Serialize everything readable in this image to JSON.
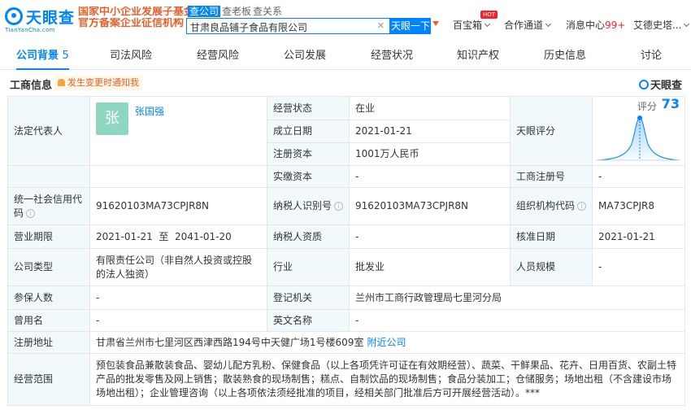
{
  "header": {
    "logo_text": "天眼查",
    "logo_domain": "TianYanCha.com",
    "banner_line1": "国家中小企业发展子基金",
    "banner_line2": "官方备案企业征信机构",
    "query_tabs": [
      "查公司",
      "查老板",
      "查关系"
    ],
    "search_value": "甘肃良品铺子食品有限公司",
    "search_button": "天眼一下",
    "nav": {
      "baibaoxiang": "百宝箱",
      "hot": "HOT",
      "channel": "合作通道",
      "messages": "消息中心",
      "messages_count": "99+",
      "user": "艾德史塔..."
    }
  },
  "tabs": [
    {
      "label": "公司背景",
      "count": "5"
    },
    {
      "label": "司法风险"
    },
    {
      "label": "经营风险"
    },
    {
      "label": "公司发展"
    },
    {
      "label": "经营状况"
    },
    {
      "label": "知识产权"
    },
    {
      "label": "历史信息"
    },
    {
      "label": "讨论"
    }
  ],
  "section": {
    "title": "工商信息",
    "alert": "发生变更时通知我",
    "brand": "天眼查"
  },
  "colors": {
    "accent": "#0084ff",
    "label_bg": "#f2f9fc",
    "alert": "#e8612c"
  },
  "biz": {
    "legal_rep_label": "法定代表人",
    "legal_rep_avatar": "张",
    "legal_rep_name": "张国强",
    "status_label": "经营状态",
    "status_value": "在业",
    "founded_label": "成立日期",
    "founded_value": "2021-01-21",
    "reg_capital_label": "注册资本",
    "reg_capital_value": "1001万人民币",
    "paid_capital_label": "实缴资本",
    "paid_capital_value": "-",
    "score_label": "天眼评分",
    "score_title": "评分",
    "score_value": "73",
    "reg_no_label": "工商注册号",
    "reg_no_value": "-",
    "credit_code_label": "统一社会信用代码",
    "credit_code_value": "91620103MA73CPJR8N",
    "taxpayer_id_label": "纳税人识别号",
    "taxpayer_id_value": "91620103MA73CPJR8N",
    "org_code_label": "组织机构代码",
    "org_code_value": "MA73CPJR8",
    "term_label": "营业期限",
    "term_value": "2021-01-21  至  2041-01-20",
    "taxpayer_qual_label": "纳税人资质",
    "taxpayer_qual_value": "-",
    "approval_date_label": "核准日期",
    "approval_date_value": "2021-01-21",
    "company_type_label": "公司类型",
    "company_type_value": "有限责任公司（非自然人投资或控股的法人独资）",
    "industry_label": "行业",
    "industry_value": "批发业",
    "staff_label": "人员规模",
    "staff_value": "-",
    "insured_label": "参保人数",
    "insured_value": "-",
    "authority_label": "登记机关",
    "authority_value": "兰州市工商行政管理局七里河分局",
    "former_name_label": "曾用名",
    "former_name_value": "-",
    "english_label": "英文名称",
    "english_value": "-",
    "address_label": "注册地址",
    "address_value": "甘肃省兰州市七里河区西津西路194号中天健广场1号楼609室",
    "address_link": "附近公司",
    "scope_label": "经营范围",
    "scope_value": "预包装食品兼散装食品、婴幼儿配方乳粉、保健食品（以上各项凭许可证在有效期经营）、蔬菜、干鲜果品、花卉、日用百货、农副土特产品的批发零售及网上销售；散装熟食的现场制售；糕点、自制饮品的现场制售；食品分装加工；仓储服务；场地出租（不含建设市场场地出租）；企业管理咨询（以上各项依法须经批准的项目，经相关部门批准后方可开展经营活动）。***"
  }
}
